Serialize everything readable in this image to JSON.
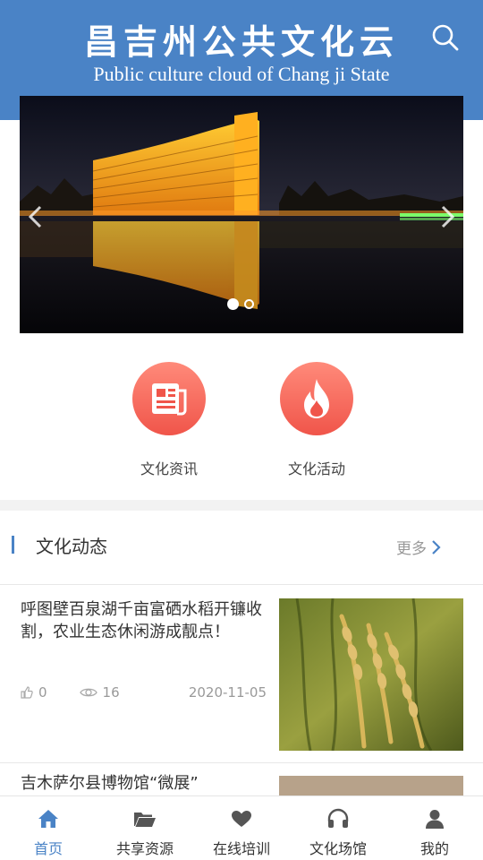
{
  "header": {
    "title_cn": "昌吉州公共文化云",
    "title_en": "Public culture cloud of Chang ji State"
  },
  "categories": [
    {
      "label": "文化资讯",
      "icon": "newspaper-icon"
    },
    {
      "label": "文化活动",
      "icon": "flame-icon"
    }
  ],
  "section": {
    "title": "文化动态",
    "more_label": "更多"
  },
  "news": [
    {
      "title": "呼图壁百泉湖千亩富硒水稻开镰收割，农业生态休闲游成靓点！",
      "likes": "0",
      "views": "16",
      "date": "2020-11-05"
    },
    {
      "title": "吉木萨尔县博物馆“微展”"
    }
  ],
  "bottom_nav": [
    {
      "label": "首页",
      "icon": "home-icon",
      "active": true
    },
    {
      "label": "共享资源",
      "icon": "folder-icon"
    },
    {
      "label": "在线培训",
      "icon": "heart-icon"
    },
    {
      "label": "文化场馆",
      "icon": "headphones-icon"
    },
    {
      "label": "我的",
      "icon": "user-icon"
    }
  ],
  "colors": {
    "brand_blue": "#4a83c6",
    "accent_red": "#f0554a"
  }
}
